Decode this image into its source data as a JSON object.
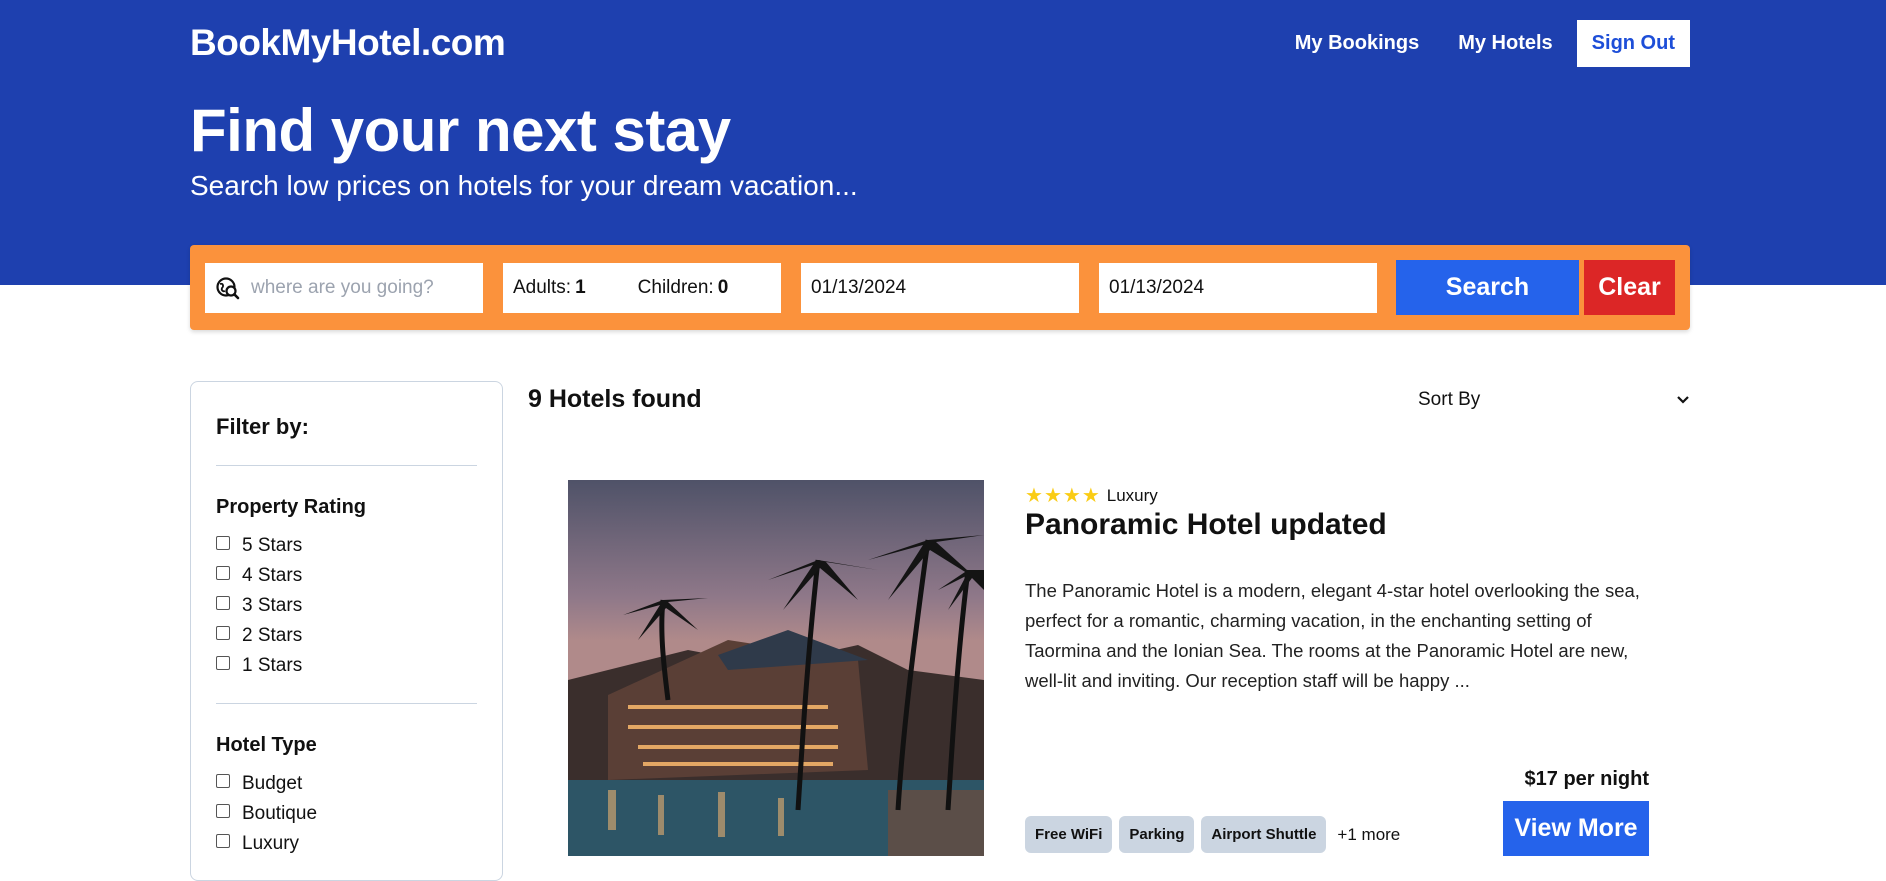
{
  "header": {
    "logo": "BookMyHotel.com",
    "nav": {
      "my_bookings": "My Bookings",
      "my_hotels": "My Hotels",
      "sign_out": "Sign Out"
    },
    "title": "Find your next stay",
    "subtitle": "Search low prices on hotels for your dream vacation..."
  },
  "search": {
    "destination_placeholder": "where are you going?",
    "adults_label": "Adults:",
    "adults_value": "1",
    "children_label": "Children:",
    "children_value": "0",
    "check_in": "01/13/2024",
    "check_out": "01/13/2024",
    "search_label": "Search",
    "clear_label": "Clear"
  },
  "filters": {
    "heading": "Filter by:",
    "rating": {
      "title": "Property Rating",
      "options": [
        "5 Stars",
        "4 Stars",
        "3 Stars",
        "2 Stars",
        "1 Stars"
      ]
    },
    "type": {
      "title": "Hotel Type",
      "options": [
        "Budget",
        "Boutique",
        "Luxury"
      ]
    }
  },
  "results": {
    "count_text": "9 Hotels found",
    "sort_label": "Sort By"
  },
  "hotel": {
    "star_count": 4,
    "type": "Luxury",
    "name": "Panoramic Hotel updated",
    "description": "The Panoramic Hotel is a modern, elegant 4-star hotel overlooking the sea, perfect for a romantic, charming vacation, in the enchanting setting of Taormina and the Ionian Sea. The rooms at the Panoramic Hotel are new, well-lit and inviting. Our reception staff will be happy ...",
    "facilities": [
      "Free WiFi",
      "Parking",
      "Airport Shuttle"
    ],
    "more_facilities": "+1 more",
    "price": "$17 per night",
    "view_more": "View More"
  },
  "colors": {
    "primary": "#1e40af",
    "accent": "#fb923c",
    "button": "#2563eb",
    "danger": "#dc2626",
    "star": "#facc15"
  }
}
